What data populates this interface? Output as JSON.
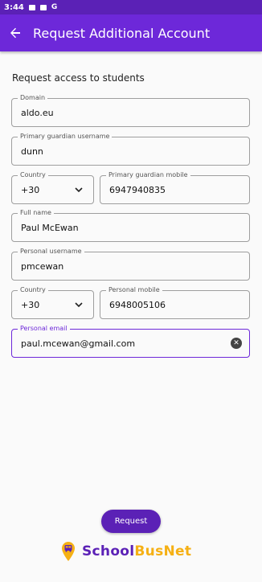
{
  "status_bar": {
    "time": "3:44",
    "g_label": "G"
  },
  "app_bar": {
    "title": "Request Additional Account"
  },
  "form": {
    "section_title": "Request access to students",
    "domain": {
      "label": "Domain",
      "value": "aldo.eu"
    },
    "guardian_username": {
      "label": "Primary guardian username",
      "value": "dunn"
    },
    "guardian_country": {
      "label": "Country",
      "value": "+30"
    },
    "guardian_mobile": {
      "label": "Primary guardian mobile",
      "value": "6947940835"
    },
    "full_name": {
      "label": "Full name",
      "value": "Paul McEwan"
    },
    "personal_username": {
      "label": "Personal username",
      "value": "pmcewan"
    },
    "personal_country": {
      "label": "Country",
      "value": "+30"
    },
    "personal_mobile": {
      "label": "Personal mobile",
      "value": "6948005106"
    },
    "personal_email": {
      "label": "Personal email",
      "value": "paul.mcewan@gmail.com"
    }
  },
  "actions": {
    "request_label": "Request"
  },
  "branding": {
    "logo_part1": "School",
    "logo_part2": "BusNet"
  },
  "colors": {
    "primary": "#6d28d9",
    "primary_dark": "#5b21b6",
    "accent": "#f5b014"
  }
}
